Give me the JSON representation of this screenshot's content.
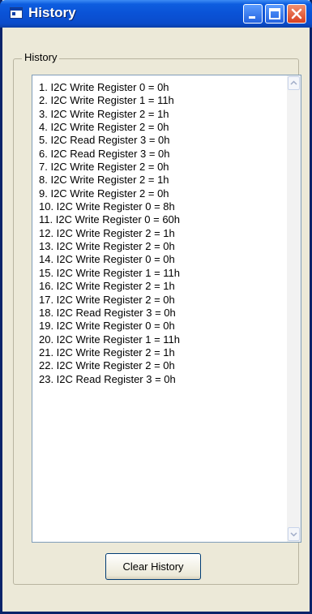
{
  "window": {
    "title": "History"
  },
  "group": {
    "label": "History"
  },
  "history": {
    "items": [
      "1. I2C Write Register 0 = 0h",
      "2. I2C Write Register 1 = 11h",
      "3. I2C Write Register 2 = 1h",
      "4. I2C Write Register 2 = 0h",
      "5. I2C Read Register 3 = 0h",
      "6. I2C Read Register 3 = 0h",
      "7. I2C Write Register 2 = 0h",
      "8. I2C Write Register 2 = 1h",
      "9. I2C Write Register 2 = 0h",
      "10. I2C Write Register 0 = 8h",
      "11. I2C Write Register 0 = 60h",
      "12. I2C Write Register 2 = 1h",
      "13. I2C Write Register 2 = 0h",
      "14. I2C Write Register 0 = 0h",
      "15. I2C Write Register 1 = 11h",
      "16. I2C Write Register 2 = 1h",
      "17. I2C Write Register 2 = 0h",
      "18. I2C Read Register 3 = 0h",
      "19. I2C Write Register 0 = 0h",
      "20. I2C Write Register 1 = 11h",
      "21. I2C Write Register 2 = 1h",
      "22. I2C Write Register 2 = 0h",
      "23. I2C Read Register 3 = 0h"
    ]
  },
  "buttons": {
    "clear_label": "Clear History"
  },
  "icons": {
    "app": "window-app-icon",
    "minimize": "minimize-icon",
    "maximize": "maximize-icon",
    "close": "close-icon",
    "scroll_up": "chevron-up-icon",
    "scroll_down": "chevron-down-icon"
  },
  "colors": {
    "titlebar": "#0a52d6",
    "window_bg": "#ece9d8",
    "close_button": "#d84020"
  }
}
